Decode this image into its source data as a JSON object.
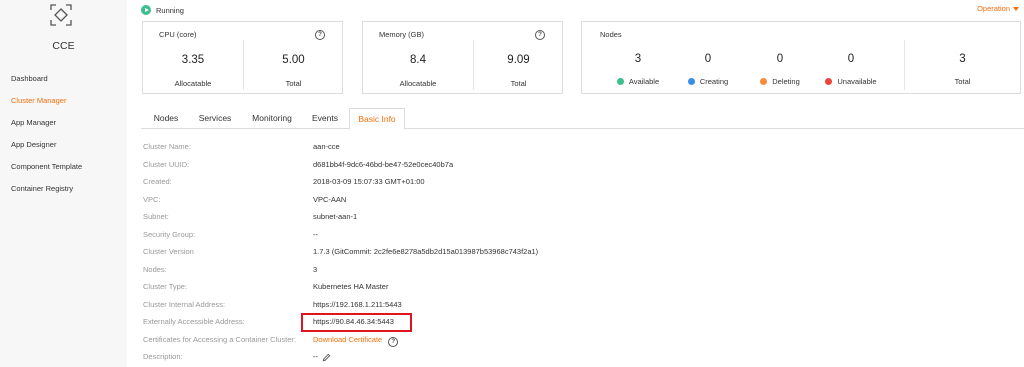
{
  "sidebar": {
    "logo_label": "CCE",
    "items": [
      {
        "label": "Dashboard",
        "active": false
      },
      {
        "label": "Cluster Manager",
        "active": true
      },
      {
        "label": "App Manager",
        "active": false
      },
      {
        "label": "App Designer",
        "active": false
      },
      {
        "label": "Component Template",
        "active": false
      },
      {
        "label": "Container Registry",
        "active": false
      }
    ]
  },
  "header": {
    "status": "Running",
    "operation_label": "Operation"
  },
  "cpu_card": {
    "title": "CPU (core)",
    "allocatable_value": "3.35",
    "allocatable_label": "Allocatable",
    "total_value": "5.00",
    "total_label": "Total"
  },
  "memory_card": {
    "title": "Memory (GB)",
    "allocatable_value": "8.4",
    "allocatable_label": "Allocatable",
    "total_value": "9.09",
    "total_label": "Total"
  },
  "nodes_card": {
    "title": "Nodes",
    "available_value": "3",
    "available_label": "Available",
    "creating_value": "0",
    "creating_label": "Creating",
    "deleting_value": "0",
    "deleting_label": "Deleting",
    "unavailable_value": "0",
    "unavailable_label": "Unavailable",
    "total_value": "3",
    "total_label": "Total"
  },
  "colors": {
    "accent": "#f66f0c",
    "available": "#3bbf8d",
    "creating": "#3a8ee6",
    "deleting": "#f58a3a",
    "unavailable": "#e8453c",
    "highlight_box": "#e0141e"
  },
  "tabs": [
    {
      "label": "Nodes",
      "active": false
    },
    {
      "label": "Services",
      "active": false
    },
    {
      "label": "Monitoring",
      "active": false
    },
    {
      "label": "Events",
      "active": false
    },
    {
      "label": "Basic Info",
      "active": true
    }
  ],
  "basic_info": [
    {
      "key": "Cluster Name:",
      "value": "aan-cce"
    },
    {
      "key": "Cluster UUID:",
      "value": "d681bb4f-9dc6-46bd-be47-52e0cec40b7a"
    },
    {
      "key": "Created:",
      "value": "2018-03-09 15:07:33 GMT+01:00"
    },
    {
      "key": "VPC:",
      "value": "VPC-AAN"
    },
    {
      "key": "Subnet:",
      "value": "subnet-aan-1"
    },
    {
      "key": "Security Group:",
      "value": "--"
    },
    {
      "key": "Cluster Version",
      "value": "1.7.3 (GitCommit: 2c2fe6e8278a5db2d15a013987b53968c743f2a1)"
    },
    {
      "key": "Nodes:",
      "value": "3"
    },
    {
      "key": "Cluster Type:",
      "value": "Kubernetes HA Master"
    },
    {
      "key": "Cluster Internal Address:",
      "value": "https://192.168.1.211:5443"
    },
    {
      "key": "Externally Accessible Address:",
      "value": "https://90.84.46.34:5443"
    },
    {
      "key": "Certificates for Accessing a Container Cluster:",
      "value": "Download Certificate"
    },
    {
      "key": "Description:",
      "value": "--"
    }
  ],
  "icons": {
    "logo": "cube-logo-icon",
    "status": "play-circle-icon",
    "help": "question-circle-icon",
    "edit": "pencil-icon",
    "operation": "caret-down-icon"
  }
}
